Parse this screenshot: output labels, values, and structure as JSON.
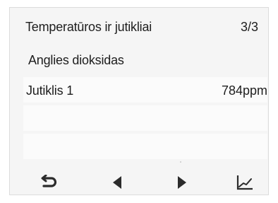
{
  "header": {
    "title": "Temperatūros ir jutikliai",
    "page_indicator": "3/3"
  },
  "section": {
    "title": "Anglies dioksidas"
  },
  "rows": [
    {
      "label": "Jutiklis 1",
      "value": "784ppm"
    },
    {
      "label": "",
      "value": ""
    },
    {
      "label": "",
      "value": ""
    }
  ],
  "toolbar": {
    "icons": [
      "back-icon",
      "previous-icon",
      "next-icon",
      "chart-icon"
    ]
  },
  "colors": {
    "screen_background": "#f5f5f5",
    "row_background": "#fbfbfb",
    "text": "#1e1e1e",
    "icon": "#2b2b2b"
  }
}
